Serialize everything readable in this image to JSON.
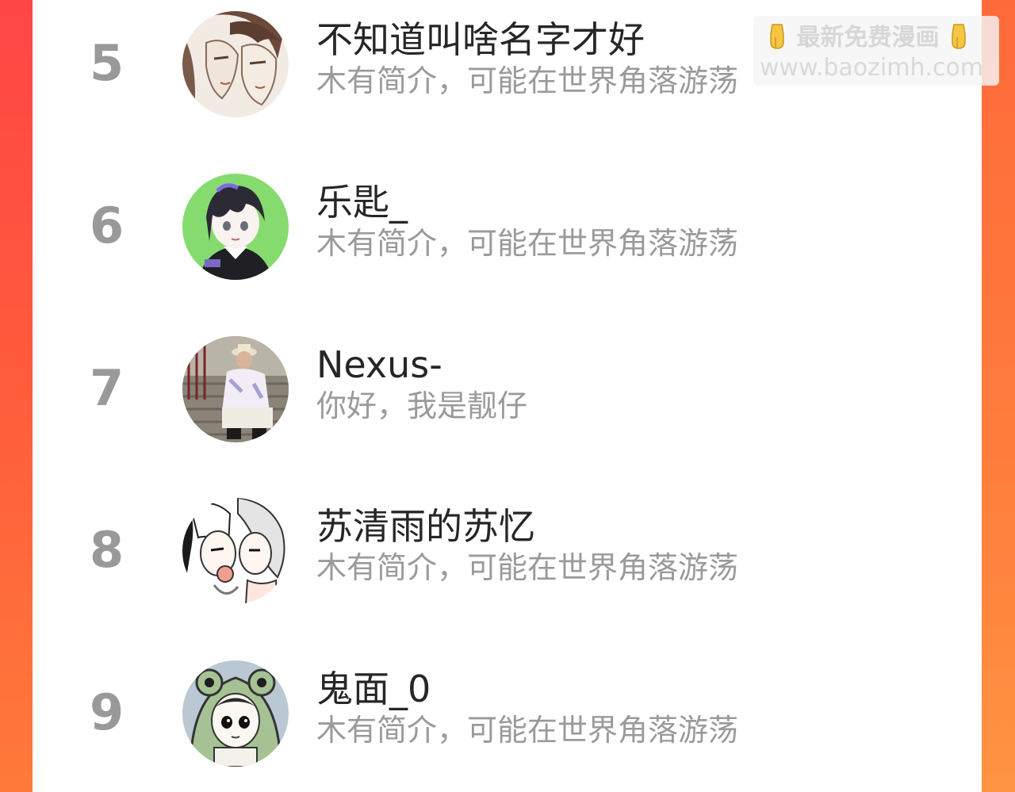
{
  "watermark": {
    "title": "最新免费漫画",
    "url": "www.baozimh.com",
    "icon": "pointing-down-hand-icon",
    "color": "#d7d7d7"
  },
  "colors": {
    "rank": "#999999",
    "name": "#262626",
    "bio": "#9a9a9a",
    "frame_left": "#ff4646",
    "frame_right": "#ff7e3c"
  },
  "users": [
    {
      "rank": "5",
      "name": "不知道叫啥名字才好",
      "bio": "木有简介，可能在世界角落游荡",
      "avatar": "sketch-couple-avatar"
    },
    {
      "rank": "6",
      "name": "乐匙_",
      "bio": "木有简介，可能在世界角落游荡",
      "avatar": "anime-boy-green-avatar"
    },
    {
      "rank": "7",
      "name": "Nexus-",
      "bio": "你好，我是靓仔",
      "avatar": "photo-man-stairs-avatar"
    },
    {
      "rank": "8",
      "name": "苏清雨的苏忆",
      "bio": "木有简介，可能在世界角落游荡",
      "avatar": "manga-couple-avatar"
    },
    {
      "rank": "9",
      "name": "鬼面_0",
      "bio": "木有简介，可能在世界角落游荡",
      "avatar": "frog-hood-avatar"
    }
  ]
}
